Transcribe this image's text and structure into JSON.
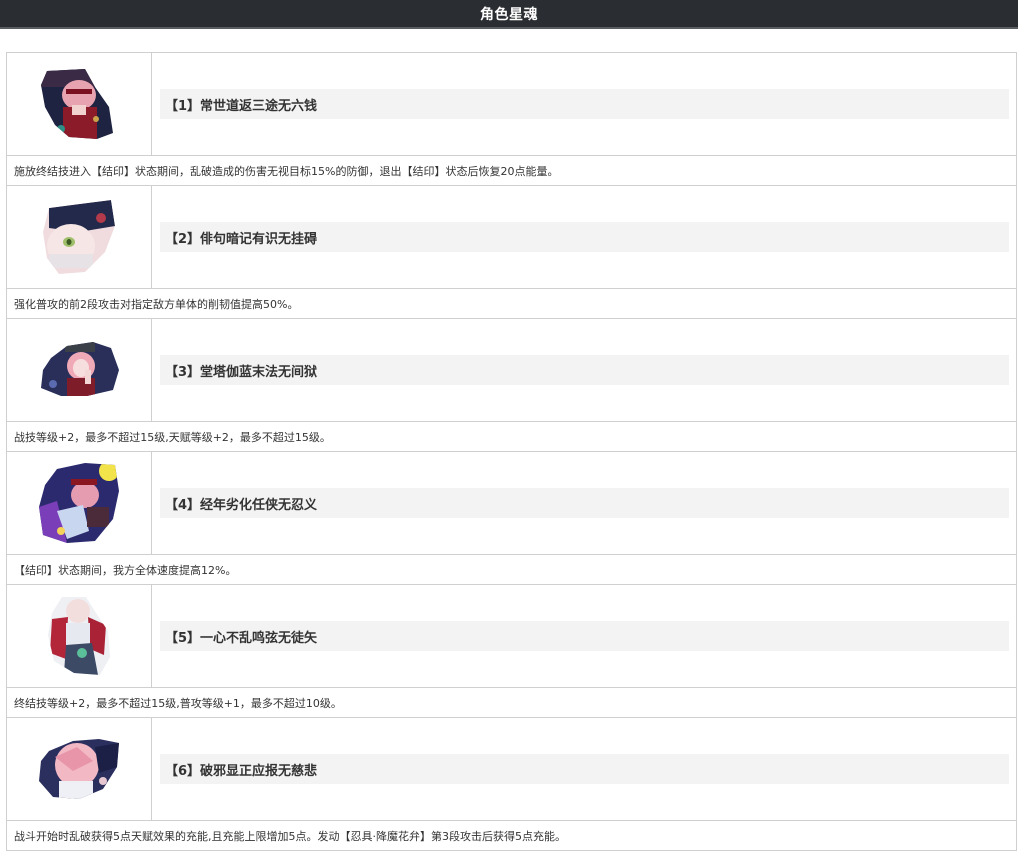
{
  "header": {
    "title": "角色星魂"
  },
  "eidolons": [
    {
      "name": "【1】常世道返三途无六钱",
      "description": "施放终结技进入【结印】状态期间，乱破造成的伤害无视目标15%的防御，退出【结印】状态后恢复20点能量。"
    },
    {
      "name": "【2】俳句暗记有识无挂碍",
      "description": "强化普攻的前2段攻击对指定敌方单体的削韧值提高50%。"
    },
    {
      "name": "【3】堂塔伽蓝末法无间狱",
      "description": "战技等级+2，最多不超过15级,天赋等级+2，最多不超过15级。"
    },
    {
      "name": "【4】经年劣化任侠无忍义",
      "description": "【结印】状态期间，我方全体速度提高12%。"
    },
    {
      "name": "【5】一心不乱鸣弦无徒矢",
      "description": "终结技等级+2，最多不超过15级,普攻等级+1，最多不超过10级。"
    },
    {
      "name": "【6】破邪显正应报无慈悲",
      "description": "战斗开始时乱破获得5点天赋效果的充能,且充能上限增加5点。发动【忍具·降魔花弁】第3段攻击后获得5点充能。"
    }
  ],
  "colors": {
    "header_bg": "#2a2d31",
    "name_bg": "#f3f3f3",
    "border": "#cfcfcf",
    "text": "#333333"
  }
}
